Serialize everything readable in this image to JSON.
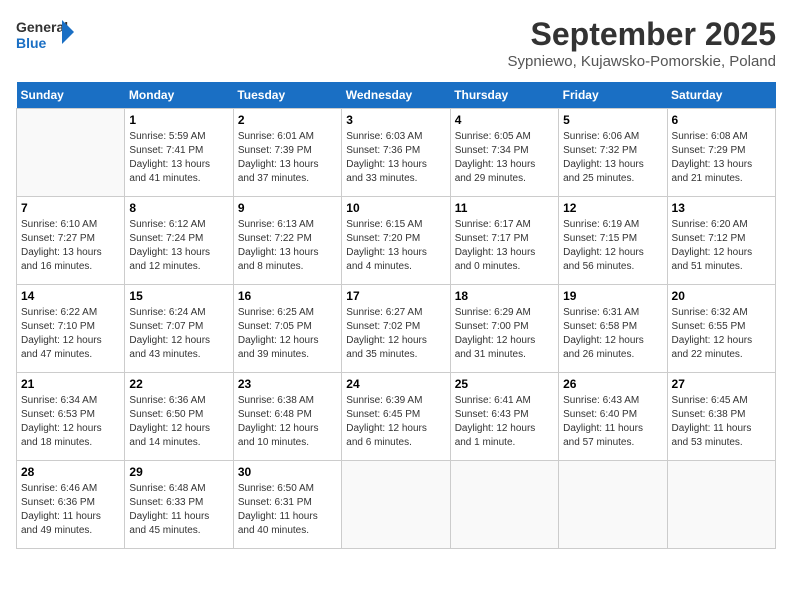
{
  "header": {
    "logo_line1": "General",
    "logo_line2": "Blue",
    "month": "September 2025",
    "location": "Sypniewo, Kujawsko-Pomorskie, Poland"
  },
  "days_of_week": [
    "Sunday",
    "Monday",
    "Tuesday",
    "Wednesday",
    "Thursday",
    "Friday",
    "Saturday"
  ],
  "weeks": [
    [
      {
        "day": "",
        "info": ""
      },
      {
        "day": "1",
        "info": "Sunrise: 5:59 AM\nSunset: 7:41 PM\nDaylight: 13 hours\nand 41 minutes."
      },
      {
        "day": "2",
        "info": "Sunrise: 6:01 AM\nSunset: 7:39 PM\nDaylight: 13 hours\nand 37 minutes."
      },
      {
        "day": "3",
        "info": "Sunrise: 6:03 AM\nSunset: 7:36 PM\nDaylight: 13 hours\nand 33 minutes."
      },
      {
        "day": "4",
        "info": "Sunrise: 6:05 AM\nSunset: 7:34 PM\nDaylight: 13 hours\nand 29 minutes."
      },
      {
        "day": "5",
        "info": "Sunrise: 6:06 AM\nSunset: 7:32 PM\nDaylight: 13 hours\nand 25 minutes."
      },
      {
        "day": "6",
        "info": "Sunrise: 6:08 AM\nSunset: 7:29 PM\nDaylight: 13 hours\nand 21 minutes."
      }
    ],
    [
      {
        "day": "7",
        "info": "Sunrise: 6:10 AM\nSunset: 7:27 PM\nDaylight: 13 hours\nand 16 minutes."
      },
      {
        "day": "8",
        "info": "Sunrise: 6:12 AM\nSunset: 7:24 PM\nDaylight: 13 hours\nand 12 minutes."
      },
      {
        "day": "9",
        "info": "Sunrise: 6:13 AM\nSunset: 7:22 PM\nDaylight: 13 hours\nand 8 minutes."
      },
      {
        "day": "10",
        "info": "Sunrise: 6:15 AM\nSunset: 7:20 PM\nDaylight: 13 hours\nand 4 minutes."
      },
      {
        "day": "11",
        "info": "Sunrise: 6:17 AM\nSunset: 7:17 PM\nDaylight: 13 hours\nand 0 minutes."
      },
      {
        "day": "12",
        "info": "Sunrise: 6:19 AM\nSunset: 7:15 PM\nDaylight: 12 hours\nand 56 minutes."
      },
      {
        "day": "13",
        "info": "Sunrise: 6:20 AM\nSunset: 7:12 PM\nDaylight: 12 hours\nand 51 minutes."
      }
    ],
    [
      {
        "day": "14",
        "info": "Sunrise: 6:22 AM\nSunset: 7:10 PM\nDaylight: 12 hours\nand 47 minutes."
      },
      {
        "day": "15",
        "info": "Sunrise: 6:24 AM\nSunset: 7:07 PM\nDaylight: 12 hours\nand 43 minutes."
      },
      {
        "day": "16",
        "info": "Sunrise: 6:25 AM\nSunset: 7:05 PM\nDaylight: 12 hours\nand 39 minutes."
      },
      {
        "day": "17",
        "info": "Sunrise: 6:27 AM\nSunset: 7:02 PM\nDaylight: 12 hours\nand 35 minutes."
      },
      {
        "day": "18",
        "info": "Sunrise: 6:29 AM\nSunset: 7:00 PM\nDaylight: 12 hours\nand 31 minutes."
      },
      {
        "day": "19",
        "info": "Sunrise: 6:31 AM\nSunset: 6:58 PM\nDaylight: 12 hours\nand 26 minutes."
      },
      {
        "day": "20",
        "info": "Sunrise: 6:32 AM\nSunset: 6:55 PM\nDaylight: 12 hours\nand 22 minutes."
      }
    ],
    [
      {
        "day": "21",
        "info": "Sunrise: 6:34 AM\nSunset: 6:53 PM\nDaylight: 12 hours\nand 18 minutes."
      },
      {
        "day": "22",
        "info": "Sunrise: 6:36 AM\nSunset: 6:50 PM\nDaylight: 12 hours\nand 14 minutes."
      },
      {
        "day": "23",
        "info": "Sunrise: 6:38 AM\nSunset: 6:48 PM\nDaylight: 12 hours\nand 10 minutes."
      },
      {
        "day": "24",
        "info": "Sunrise: 6:39 AM\nSunset: 6:45 PM\nDaylight: 12 hours\nand 6 minutes."
      },
      {
        "day": "25",
        "info": "Sunrise: 6:41 AM\nSunset: 6:43 PM\nDaylight: 12 hours\nand 1 minute."
      },
      {
        "day": "26",
        "info": "Sunrise: 6:43 AM\nSunset: 6:40 PM\nDaylight: 11 hours\nand 57 minutes."
      },
      {
        "day": "27",
        "info": "Sunrise: 6:45 AM\nSunset: 6:38 PM\nDaylight: 11 hours\nand 53 minutes."
      }
    ],
    [
      {
        "day": "28",
        "info": "Sunrise: 6:46 AM\nSunset: 6:36 PM\nDaylight: 11 hours\nand 49 minutes."
      },
      {
        "day": "29",
        "info": "Sunrise: 6:48 AM\nSunset: 6:33 PM\nDaylight: 11 hours\nand 45 minutes."
      },
      {
        "day": "30",
        "info": "Sunrise: 6:50 AM\nSunset: 6:31 PM\nDaylight: 11 hours\nand 40 minutes."
      },
      {
        "day": "",
        "info": ""
      },
      {
        "day": "",
        "info": ""
      },
      {
        "day": "",
        "info": ""
      },
      {
        "day": "",
        "info": ""
      }
    ]
  ]
}
